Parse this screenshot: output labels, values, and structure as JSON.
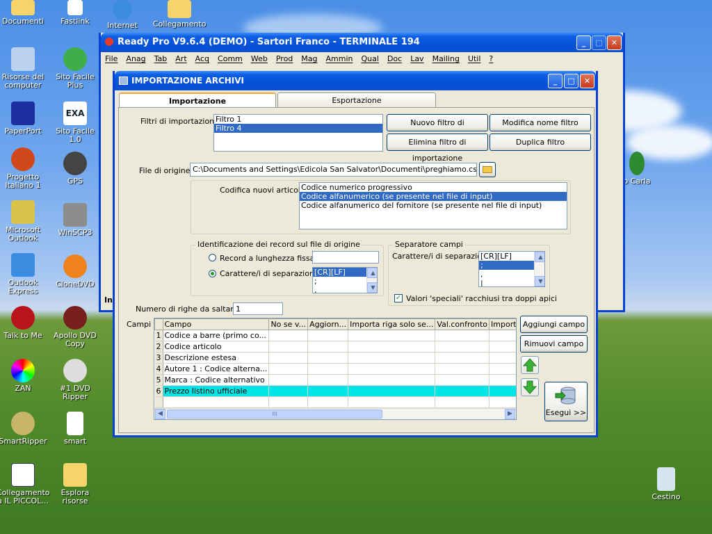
{
  "desktop": {
    "icons": [
      {
        "label": "Documenti"
      },
      {
        "label": "Fastlink"
      },
      {
        "label": "Internet"
      },
      {
        "label": "Collegamento"
      },
      {
        "label": "Risorse del computer"
      },
      {
        "label": "Sito Facile Plus"
      },
      {
        "label": "PaperPort"
      },
      {
        "label": "Sito Facile 1.0"
      },
      {
        "label": "Progetto Italiano 1"
      },
      {
        "label": "GPS"
      },
      {
        "label": "Microsoft Outlook"
      },
      {
        "label": "WinSCP3"
      },
      {
        "label": "Outlook Express"
      },
      {
        "label": "CloneDVD"
      },
      {
        "label": "Talk to Me"
      },
      {
        "label": "Apollo DVD Copy"
      },
      {
        "label": "ZAN"
      },
      {
        "label": "#1 DVD Ripper"
      },
      {
        "label": "SmartRipper"
      },
      {
        "label": "smart"
      },
      {
        "label": "Collegamento a IL PICCOL..."
      },
      {
        "label": "Esplora risorse"
      },
      {
        "label": "Cestino"
      },
      {
        "label": "o Carla"
      }
    ]
  },
  "main_window": {
    "title": "Ready Pro V9.6.4 (DEMO)  - Sartori Franco - TERMINALE 194",
    "menu": [
      "File",
      "Anag",
      "Tab",
      "Art",
      "Acq",
      "Comm",
      "Web",
      "Prod",
      "Mag",
      "Ammin",
      "Qual",
      "Doc",
      "Lav",
      "Mailing",
      "Util",
      "?"
    ],
    "status_fragment": "In"
  },
  "dialog": {
    "title": "IMPORTAZIONE ARCHIVI",
    "tabs": [
      "Importazione",
      "Esportazione"
    ],
    "filters_label": "Filtri di importazione :",
    "filters": [
      "Filtro 1",
      "Filtro 4"
    ],
    "buttons": {
      "new_filter": "Nuovo filtro di importazione",
      "rename_filter": "Modifica nome filtro",
      "delete_filter": "Elimina filtro di importazione",
      "duplicate_filter": "Duplica filtro",
      "add_field": "Aggiungi campo",
      "remove_field": "Rimuovi campo",
      "execute": "Esegui >>"
    },
    "source_file_label": "File di origine :",
    "source_file": "C:\\Documents and Settings\\Edicola San Salvator\\Documenti\\preghiamo.csv",
    "coding_label": "Codifica nuovi articoli :",
    "coding_options": [
      "Codice numerico progressivo",
      "Codice alfanumerico (se presente nel file di input)",
      "Codice alfanumerico del fornitore (se presente nel file di input)"
    ],
    "record_group": {
      "title": "Identificazione dei record sul file di origine",
      "option_fixed": "Record a lunghezza fissa",
      "option_sep": "Carattere/i di separazione",
      "sep_items": [
        "[CR][LF]",
        ";",
        ","
      ]
    },
    "field_sep_group": {
      "title": "Separatore campi",
      "label": "Carattere/i di separazione",
      "items": [
        "[CR][LF]",
        ";",
        ",",
        "|"
      ],
      "quoted_label": "Valori 'speciali' racchiusi tra doppi apici"
    },
    "skip_rows_label": "Numero di righe da saltare :",
    "skip_rows": "1",
    "fields_label": "Campi :",
    "grid": {
      "columns": [
        "Campo",
        "No se v...",
        "Aggiorn...",
        "Importa riga solo se...",
        "Val.confronto",
        "Importa ca"
      ],
      "rows": [
        {
          "n": "1",
          "campo": "Codice a barre (primo co..."
        },
        {
          "n": "2",
          "campo": "Codice articolo"
        },
        {
          "n": "3",
          "campo": "Descrizione estesa"
        },
        {
          "n": "4",
          "campo": "Autore 1 : Codice alterna..."
        },
        {
          "n": "5",
          "campo": "Marca : Codice alternativo"
        },
        {
          "n": "6",
          "campo": "Prezzo listino ufficiale"
        }
      ],
      "hscroll_label": "III"
    }
  }
}
